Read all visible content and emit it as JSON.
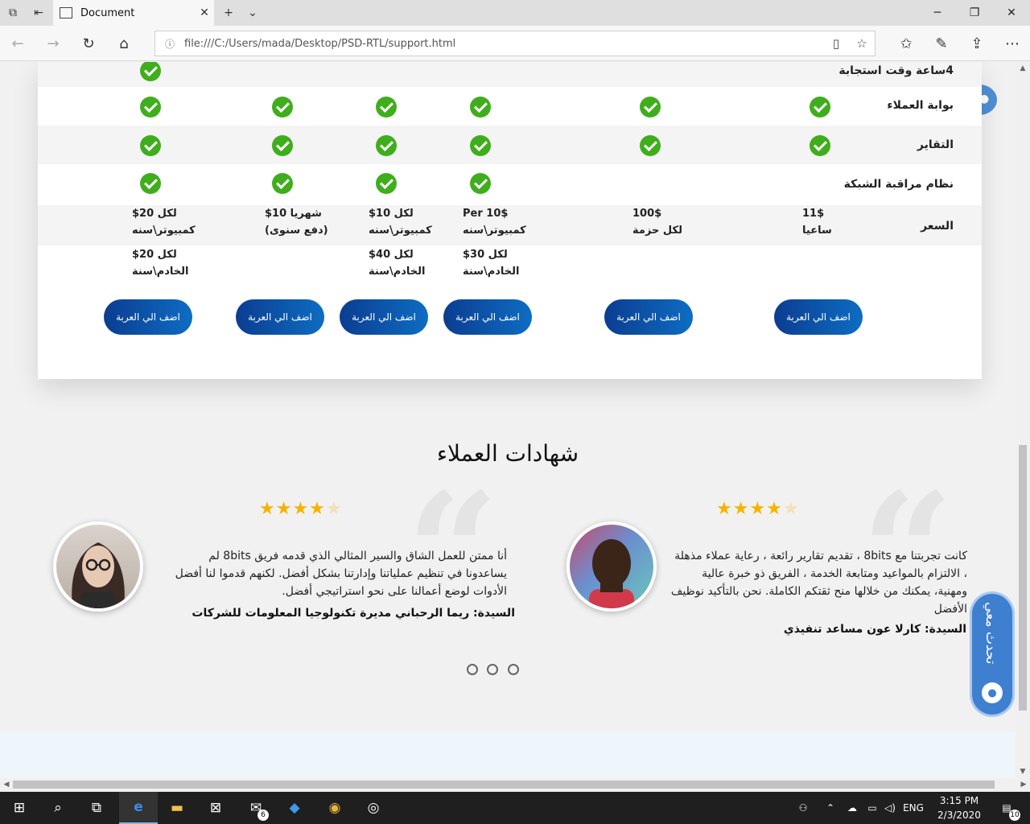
{
  "browser": {
    "tab_title": "Document",
    "url": "file:///C:/Users/mada/Desktop/PSD-RTL/support.html"
  },
  "pricing": {
    "features": [
      {
        "label": "4ساعة وقت استجابة"
      },
      {
        "label": "بوابة العملاء"
      },
      {
        "label": "التقاير"
      },
      {
        "label": "نظام مراقبة الشبكة"
      }
    ],
    "price_label": "السعر",
    "prices": [
      {
        "line1": "11$",
        "line2": "ساعيا"
      },
      {
        "line1": "100$",
        "line2": "لكل حزمة"
      },
      {
        "line1": "10$ Per",
        "line2": "كمبيوتر\\سنه"
      },
      {
        "line1": "لكل  10$",
        "line2": "كمبيوتر\\سنه"
      },
      {
        "line1": "شهريا  10$",
        "line2": "(دفع سنوى)"
      },
      {
        "line1": "لكل  20$",
        "line2": "كمبيوتر\\سنه"
      }
    ],
    "server_prices": [
      {
        "line1": "لكل  30$",
        "line2": "الخادم\\سنة"
      },
      {
        "line1": "لكل  40$",
        "line2": "الخادم\\سنة"
      },
      {
        "line1": "لكل  20$",
        "line2": "الخادم\\سنة"
      }
    ],
    "cart_button_label": "اضف الي العربة"
  },
  "testimonials": {
    "title": "شهادات العملاء",
    "items": [
      {
        "rating": 4,
        "text": "كانت تجربتنا مع 8bits ، تقديم تقارير رائعة ، رعاية عملاء مذهلة ، الالتزام بالمواعيد ومتابعة الخدمة ، الفريق ذو خبرة عالية ومهنية، يمكنك من خلالها منح ثقتكم الكاملة. نحن بالتأكيد نوظيف الأفضل",
        "author": "السيدة: كارلا عون مساعد تنفيذي"
      },
      {
        "rating": 4,
        "text": "أنا ممتن للعمل الشاق والسير المثالي الذي قدمه فريق 8bits لم يساعدونا في تنظيم عملياتنا وإدارتنا بشكل أفضل. لكنهم قدموا لنا أفضل الأدوات لوضع أعمالنا على نحو استراتيجي أفضل.",
        "author": "السيدة: ريما الرحباني مديرة تكنولوجيا المعلومات للشركات"
      }
    ]
  },
  "chat_widget": {
    "label": "تحدث معي"
  },
  "taskbar": {
    "language": "ENG",
    "time": "3:15 PM",
    "date": "2/3/2020",
    "mail_badge": "6",
    "notification_badge": "10"
  }
}
